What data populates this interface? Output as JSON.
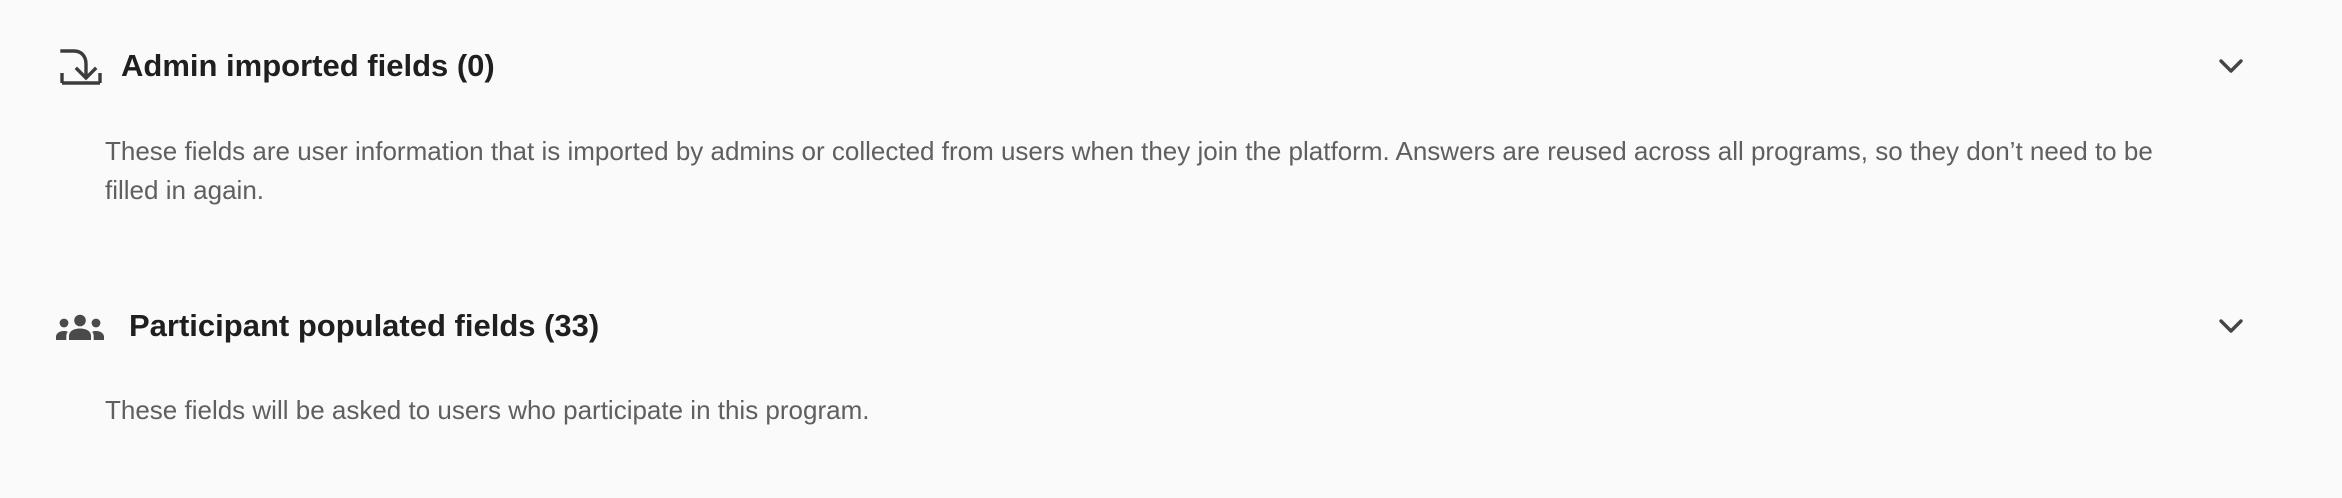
{
  "sections": [
    {
      "title": "Admin imported fields (0)",
      "description": "These fields are user information that is imported by admins or collected from users when they join the platform. Answers are reused across all programs, so they don’t need to be filled in again.",
      "icon": "download-tray-icon",
      "expanded": false
    },
    {
      "title": "Participant populated fields (33)",
      "description": "These fields will be asked to users who participate in this program.",
      "icon": "group-people-icon",
      "expanded": false
    }
  ],
  "colors": {
    "background": "#fafafa",
    "title": "#1f1f1f",
    "description": "#5f5f5f",
    "icon": "#3c3c3c"
  }
}
